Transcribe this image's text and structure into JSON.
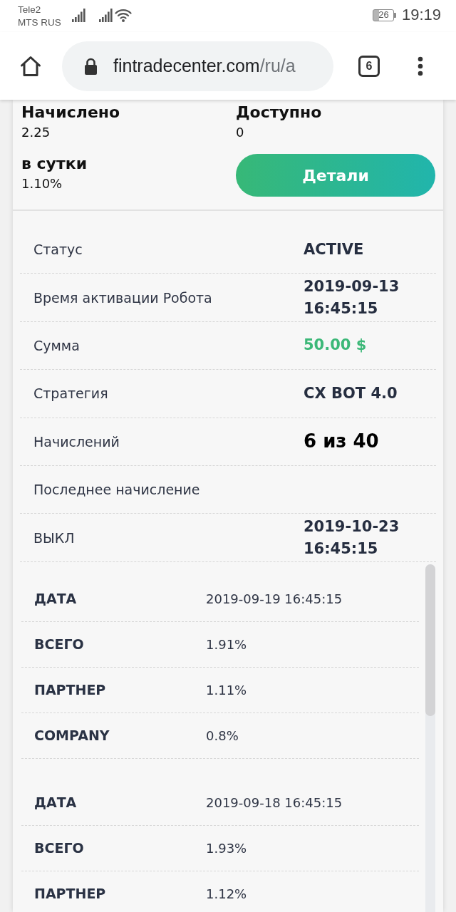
{
  "status_bar": {
    "carriers": [
      "Tele2",
      "MTS RUS"
    ],
    "battery": "26",
    "time": "19:19"
  },
  "browser": {
    "url_host": "fintradecenter.com",
    "url_path": "/ru/a",
    "tab_count": "6"
  },
  "summary": {
    "fields": [
      {
        "label": "Начислено",
        "value": "2.25"
      },
      {
        "label": "Доступно",
        "value": "0"
      },
      {
        "label": "в сутки",
        "value": "1.10%"
      }
    ],
    "details_button": "Детали"
  },
  "info_rows": [
    {
      "label": "Статус",
      "value": "ACTIVE",
      "kind": "status"
    },
    {
      "label": "Время активации Робота",
      "value": "2019-09-13 16:45:15",
      "kind": "datetime"
    },
    {
      "label": "Сумма",
      "value": "50.00 $",
      "kind": "amount"
    },
    {
      "label": "Стратегия",
      "value": "CX BOT 4.0",
      "kind": "text"
    },
    {
      "label": "Начислений",
      "value": "6 из 40",
      "kind": "count"
    },
    {
      "label": "Последнее начисление",
      "kind": "datetime"
    },
    {
      "label": "ВЫКЛ",
      "value": "2019-10-23 16:45:15",
      "kind": "datetime"
    }
  ],
  "accruals": [
    {
      "rows": [
        {
          "label": "ДАТА",
          "value": "2019-09-19 16:45:15"
        },
        {
          "label": "ВСЕГО",
          "value": "1.91%"
        },
        {
          "label": "ПАРТНЕР",
          "value": "1.11%"
        },
        {
          "label": "COMPANY",
          "value": "0.8%"
        }
      ]
    },
    {
      "rows": [
        {
          "label": "ДАТА",
          "value": "2019-09-18 16:45:15"
        },
        {
          "label": "ВСЕГО",
          "value": "1.93%"
        },
        {
          "label": "ПАРТНЕР",
          "value": "1.12%"
        }
      ]
    }
  ]
}
